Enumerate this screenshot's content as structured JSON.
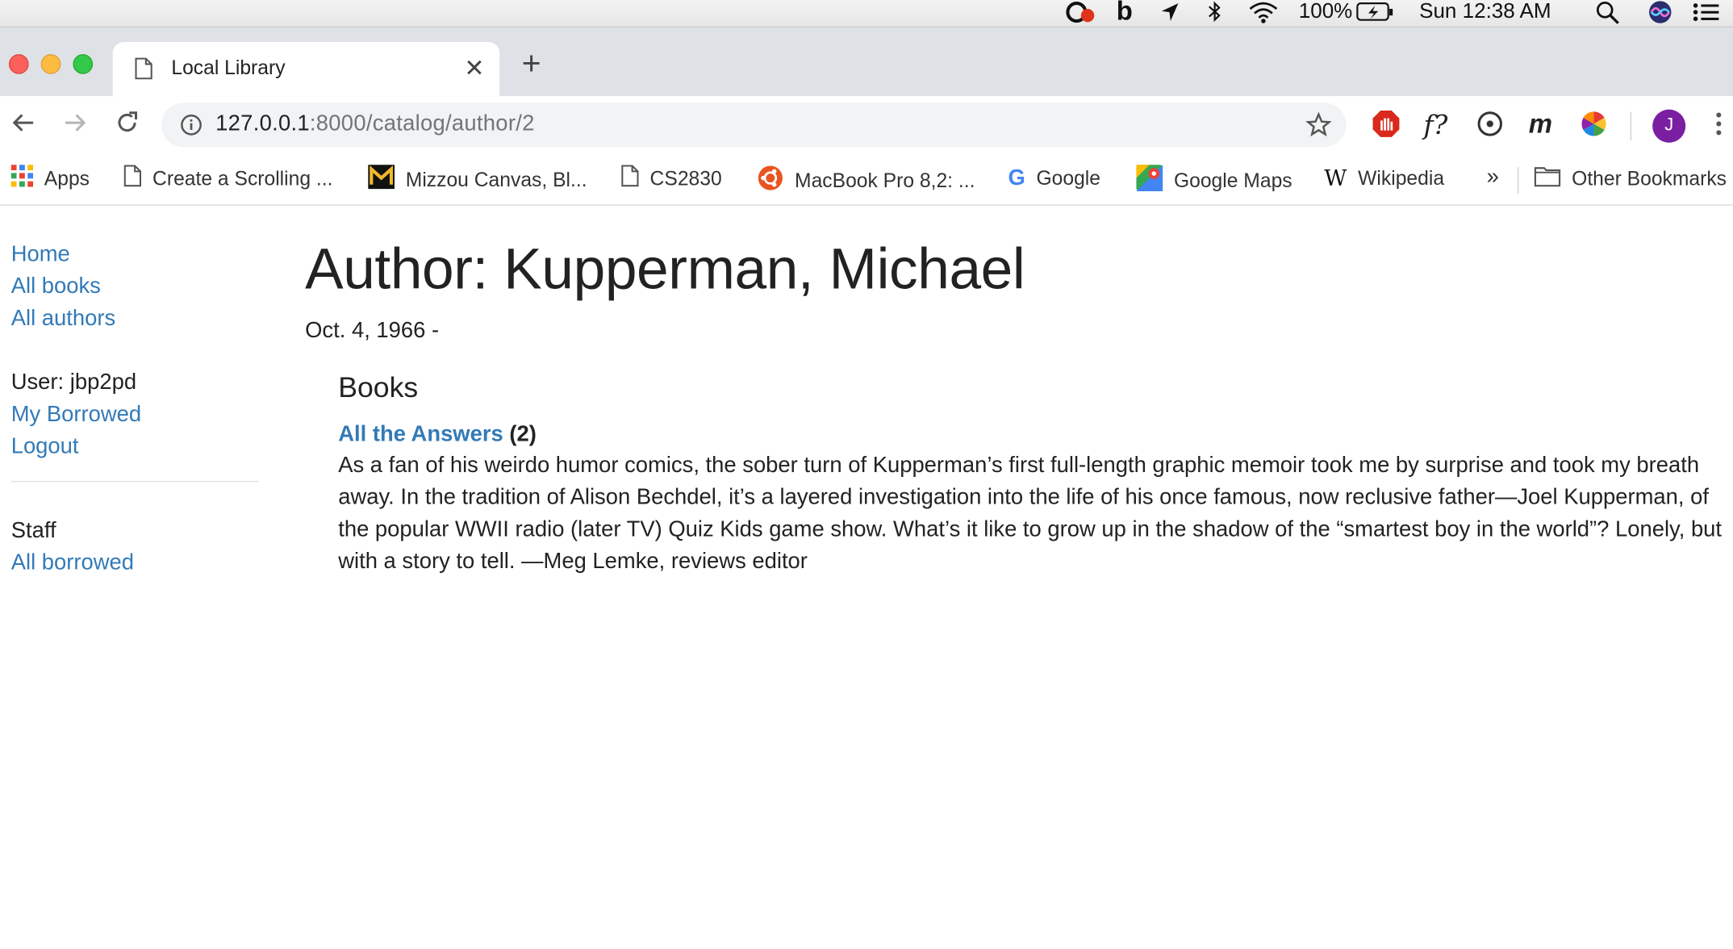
{
  "menubar": {
    "battery": "100%",
    "clock": "Sun 12:38 AM"
  },
  "tab": {
    "title": "Local Library"
  },
  "omnibox": {
    "host": "127.0.0.1",
    "rest": ":8000/catalog/author/2"
  },
  "profile": {
    "initial": "J"
  },
  "bookmarks": [
    {
      "label": "Apps",
      "icon": "apps-grid-icon"
    },
    {
      "label": "Create a Scrolling ...",
      "icon": "page-icon"
    },
    {
      "label": "Mizzou Canvas, Bl...",
      "icon": "mizzou-icon"
    },
    {
      "label": "CS2830",
      "icon": "page-icon"
    },
    {
      "label": "MacBook Pro 8,2: ...",
      "icon": "ubuntu-icon"
    },
    {
      "label": "Google",
      "icon": "google-icon"
    },
    {
      "label": "Google Maps",
      "icon": "maps-icon"
    },
    {
      "label": "Wikipedia",
      "icon": "wikipedia-icon"
    }
  ],
  "bookmarks_overflow": "»",
  "other_bookmarks": "Other Bookmarks",
  "sidebar": {
    "home": "Home",
    "all_books": "All books",
    "all_authors": "All authors",
    "user": "User: jbp2pd",
    "my_borrowed": "My Borrowed",
    "logout": "Logout",
    "staff": "Staff",
    "all_borrowed": "All borrowed"
  },
  "author": {
    "heading": "Author: Kupperman, Michael",
    "dates": "Oct. 4, 1966 -"
  },
  "books": {
    "heading": "Books",
    "items": [
      {
        "title": "All the Answers",
        "id_suffix": "(2)",
        "summary": "As a fan of his weirdo humor comics, the sober turn of Kupperman’s first full-length graphic memoir took me by surprise and took my breath away. In the tradition of Alison Bechdel, it’s a layered investigation into the life of his once famous, now reclusive father—Joel Kupperman, of the popular WWII radio (later TV) Quiz Kids game show. What’s it like to grow up in the shadow of the “smartest boy in the world”? Lonely, but with a story to tell. —Meg Lemke, reviews editor"
      }
    ]
  }
}
